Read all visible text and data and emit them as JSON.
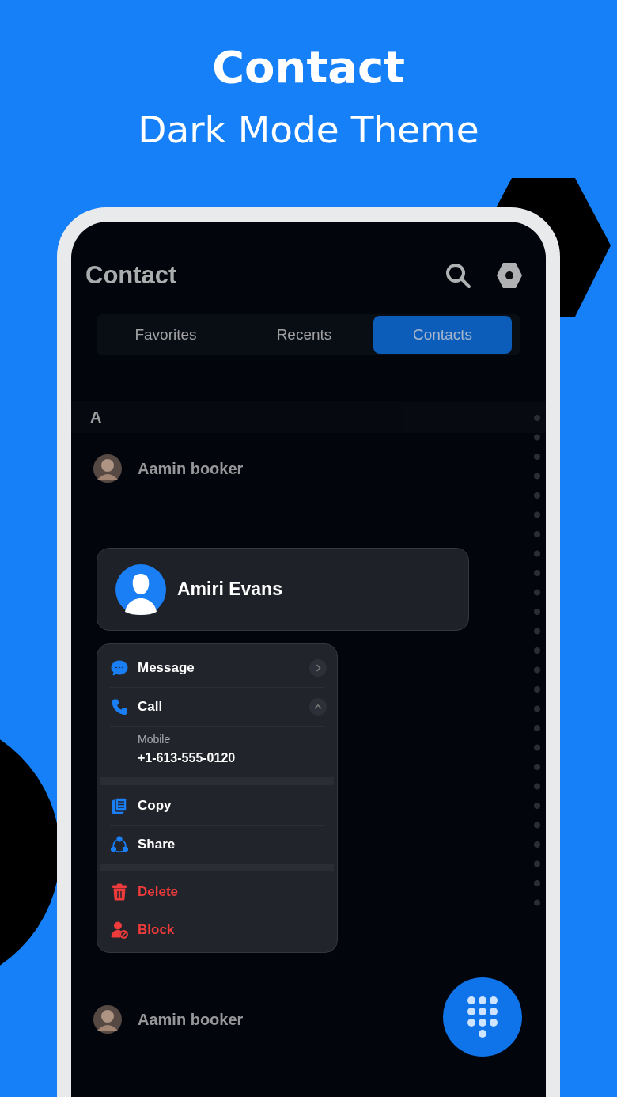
{
  "banner": {
    "title": "Contact",
    "subtitle": "Dark Mode Theme"
  },
  "app": {
    "title": "Contact",
    "tabs": [
      {
        "label": "Favorites",
        "selected": false
      },
      {
        "label": "Recents",
        "selected": false
      },
      {
        "label": "Contacts",
        "selected": true
      }
    ],
    "section": "A",
    "contacts": [
      {
        "name": "Aamin booker"
      }
    ],
    "lower_contacts": [
      {
        "name": "Aamin booker"
      }
    ]
  },
  "contact_card": {
    "name": "Amiri Evans"
  },
  "menu": {
    "groups": [
      [
        {
          "kind": "action",
          "label": "Message",
          "expanded": false
        },
        {
          "kind": "action",
          "label": "Call",
          "expanded": true,
          "detail": {
            "label": "Mobile",
            "value": "+1-613-555-0120"
          }
        }
      ],
      [
        {
          "kind": "action",
          "label": "Copy"
        },
        {
          "kind": "action",
          "label": "Share"
        }
      ],
      [
        {
          "kind": "destructive",
          "label": "Delete"
        },
        {
          "kind": "destructive",
          "label": "Block"
        }
      ]
    ]
  }
}
